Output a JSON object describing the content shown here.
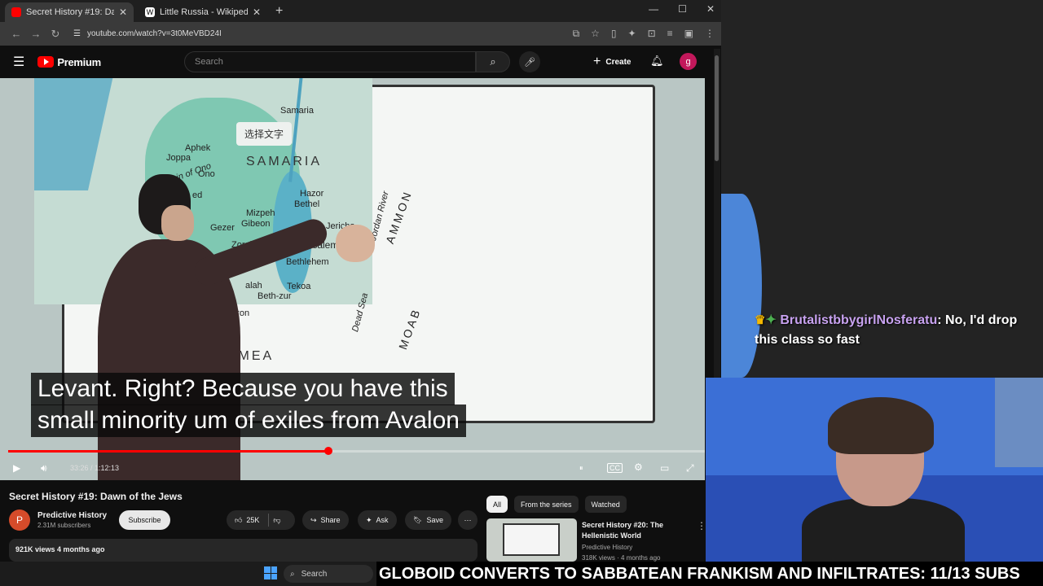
{
  "browser": {
    "tabs": [
      {
        "label": "Secret History #19: Dawn of the",
        "favicon_color": "#ff0000",
        "active": true
      },
      {
        "label": "Little Russia - Wikipedia",
        "favicon_color": "#ffffff",
        "active": false
      }
    ],
    "new_tab": "+",
    "url": "youtube.com/watch?v=3t0MeVBD24I"
  },
  "youtube": {
    "logo_text": "Premium",
    "search_placeholder": "Search",
    "create_label": "Create",
    "avatar_letter": "g",
    "video": {
      "map_labels": {
        "samaria_town": "Samaria",
        "aphek": "Aphek",
        "joppa": "Joppa",
        "ono": "Ono",
        "plain_of_ono": "Plain of Ono",
        "samaria_region": "SAMARIA",
        "hazor": "Hazor",
        "bethel": "Bethel",
        "mizpeh": "Mizpeh",
        "gibeon": "Gibeon",
        "gezer": "Gezer",
        "jericho": "Jericho",
        "zorah": "Zorah",
        "jerusalem": "Jerusalem",
        "bethlehem": "Bethlehem",
        "tekoa": "Tekoa",
        "beth_zur": "Beth-zur",
        "hebron": "Hebron",
        "idumea": "IDUMEA",
        "dead_sea": "Dead Sea",
        "jordan_river": "Jordan River",
        "ammon": "AMMON",
        "moab": "MOAB",
        "ed": "ed",
        "alah": "alah"
      },
      "ocr_overlay": "选择文字",
      "caption_line1": "Levant. Right? Because you have this",
      "caption_line2": "small minority um of exiles from Avalon",
      "time": "33:26 / 1:12:13",
      "progress_fraction": 0.46
    },
    "title": "Secret History #19: Dawn of the Jews",
    "channel": {
      "name": "Predictive History",
      "subscribers": "2.31M subscribers",
      "avatar_letter": "P"
    },
    "subscribe_label": "Subscribe",
    "actions": {
      "likes": "25K",
      "share": "Share",
      "ask": "Ask",
      "save": "Save"
    },
    "description": {
      "meta": "921K views  4 months ago"
    },
    "chips": [
      "All",
      "From the series",
      "Watched"
    ],
    "recommendation": {
      "title": "Secret History #20:  The Hellenistic World",
      "channel": "Predictive History",
      "views": "318K views · 4 months ago"
    }
  },
  "stream": {
    "chat": {
      "username": "BrutalistbbygirlNosferatu",
      "message": "No, I'd drop this class so fast"
    },
    "ticker": "GLOBOID CONVERTS TO SABBATEAN FRANKISM AND INFILTRATES: 11/13 SUBS"
  },
  "taskbar": {
    "search_label": "Search"
  }
}
